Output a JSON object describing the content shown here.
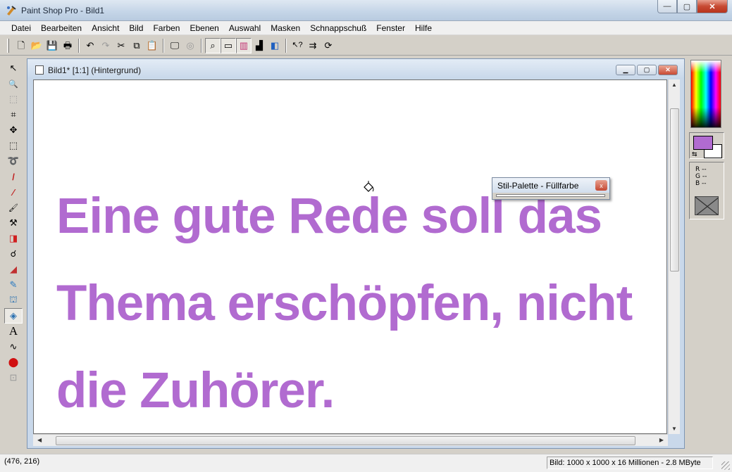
{
  "app": {
    "title": "Paint Shop Pro - Bild1",
    "window_buttons": {
      "minimize": "—",
      "maximize": "▢",
      "close": "✕"
    }
  },
  "menu": [
    "Datei",
    "Bearbeiten",
    "Ansicht",
    "Bild",
    "Farben",
    "Ebenen",
    "Auswahl",
    "Masken",
    "Schnappschuß",
    "Fenster",
    "Hilfe"
  ],
  "toolbar": {
    "buttons": [
      {
        "icon": "new-document-icon",
        "glyph": "🗋"
      },
      {
        "icon": "open-folder-icon",
        "glyph": "📂"
      },
      {
        "icon": "save-icon",
        "glyph": "💾"
      },
      {
        "icon": "print-icon",
        "glyph": "🖶"
      },
      {
        "icon": "undo-icon",
        "glyph": "↶"
      },
      {
        "icon": "redo-icon",
        "glyph": "↷"
      },
      {
        "icon": "cut-icon",
        "glyph": "✂"
      },
      {
        "icon": "copy-icon",
        "glyph": "⧉"
      },
      {
        "icon": "paste-icon",
        "glyph": "📋"
      },
      {
        "icon": "full-screen-preview-icon",
        "glyph": "🖵"
      },
      {
        "icon": "browse-icon",
        "glyph": "◎"
      },
      {
        "icon": "overview-icon",
        "glyph": "⌕"
      },
      {
        "icon": "tool-options-icon",
        "glyph": "▭"
      },
      {
        "icon": "color-palette-icon",
        "glyph": "▥"
      },
      {
        "icon": "histogram-icon",
        "glyph": "▟"
      },
      {
        "icon": "layer-palette-icon",
        "glyph": "◧"
      },
      {
        "icon": "context-help-icon",
        "glyph": "↖?"
      },
      {
        "icon": "arrange-icon",
        "glyph": "⇉"
      },
      {
        "icon": "refresh-icon",
        "glyph": "⟳"
      }
    ]
  },
  "tools": [
    {
      "icon": "arrow-tool-icon",
      "glyph": "↖"
    },
    {
      "icon": "zoom-tool-icon",
      "glyph": "🔍"
    },
    {
      "icon": "deform-tool-icon",
      "glyph": "⬚"
    },
    {
      "icon": "crop-tool-icon",
      "glyph": "⌗"
    },
    {
      "icon": "move-tool-icon",
      "glyph": "✥"
    },
    {
      "icon": "selection-tool-icon",
      "glyph": "⬚"
    },
    {
      "icon": "freehand-tool-icon",
      "glyph": "➰"
    },
    {
      "icon": "magic-wand-icon",
      "glyph": "/"
    },
    {
      "icon": "dropper-tool-icon",
      "glyph": "⁄"
    },
    {
      "icon": "paintbrush-tool-icon",
      "glyph": "🖌"
    },
    {
      "icon": "clone-brush-icon",
      "glyph": "⚒"
    },
    {
      "icon": "color-replacer-icon",
      "glyph": "◨"
    },
    {
      "icon": "retouch-tool-icon",
      "glyph": "☌"
    },
    {
      "icon": "eraser-tool-icon",
      "glyph": "◢"
    },
    {
      "icon": "picture-tube-icon",
      "glyph": "✎"
    },
    {
      "icon": "airbrush-tool-icon",
      "glyph": "⛫"
    },
    {
      "icon": "flood-fill-tool-icon",
      "glyph": "◈"
    },
    {
      "icon": "text-tool-icon",
      "glyph": "A"
    },
    {
      "icon": "draw-tool-icon",
      "glyph": "∿"
    },
    {
      "icon": "preset-shapes-icon",
      "glyph": "⬤"
    },
    {
      "icon": "object-selector-icon",
      "glyph": "⊡"
    }
  ],
  "colors": {
    "foreground": "#b16bd0",
    "background": "#ffffff",
    "text_color": "#b16bd0",
    "rgb_labels": [
      "R --",
      "G --",
      "B --"
    ]
  },
  "document": {
    "title": "Bild1* [1:1] (Hintergrund)",
    "lines": [
      "Eine gute Rede soll das",
      "Thema erschöpfen, nicht",
      "die Zuhörer."
    ]
  },
  "floating_palette": {
    "title": "Stil-Palette - Füllfarbe",
    "close": "x"
  },
  "status": {
    "coords": "(476, 216)",
    "image_info": "Bild:  1000 x 1000 x 16 Millionen - 2.8 MByte"
  }
}
